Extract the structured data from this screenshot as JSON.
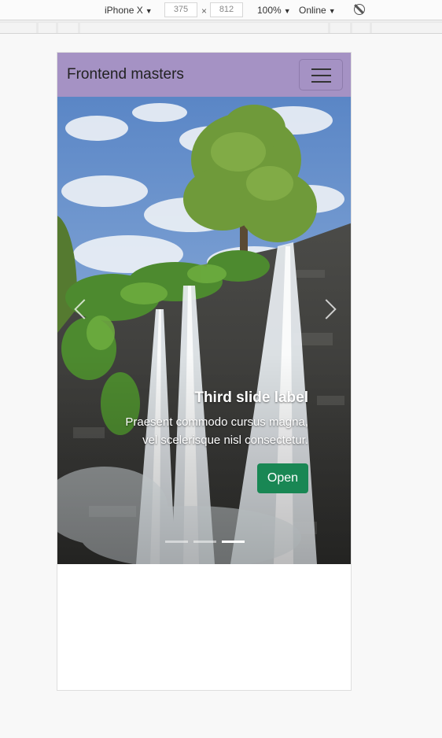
{
  "devtools": {
    "device": "iPhone X",
    "width": "375",
    "height": "812",
    "times": "×",
    "zoom": "100%",
    "network": "Online"
  },
  "navbar": {
    "brand": "Frontend masters"
  },
  "carousel": {
    "caption_title": "Third slide label",
    "caption_line1": "Praesent commodo cursus magna,",
    "caption_line2": "vel scelerisque nisl consectetur.",
    "button_label": "Open",
    "active_slide": 3,
    "slide_count": 3
  },
  "colors": {
    "navbar_bg": "#a592c4",
    "button_bg": "#198754"
  }
}
